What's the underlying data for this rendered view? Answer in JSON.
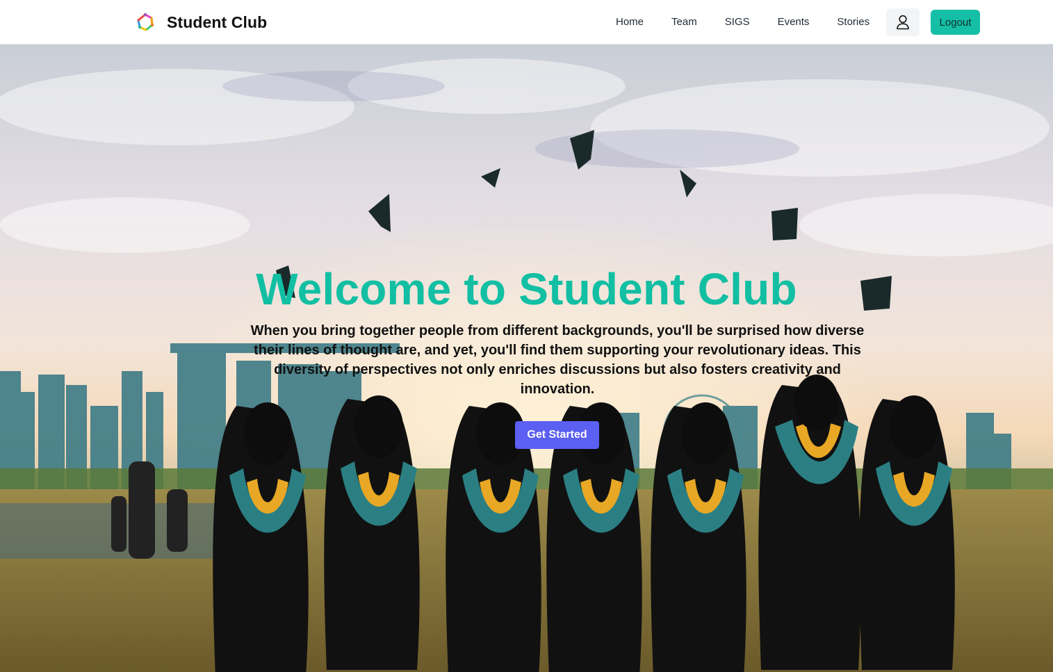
{
  "header": {
    "brand_name": "Student Club",
    "nav": [
      {
        "label": "Home"
      },
      {
        "label": "Team"
      },
      {
        "label": "SIGS"
      },
      {
        "label": "Events"
      },
      {
        "label": "Stories"
      }
    ],
    "user_icon": "user-icon",
    "logout_label": "Logout"
  },
  "hero": {
    "title": "Welcome to Student Club",
    "description": "When you bring together people from different backgrounds, you'll be surprised how diverse their lines of thought are, and yet, you'll find them supporting your revolutionary ideas. This diversity of perspectives not only enriches discussions but also fosters creativity and innovation.",
    "cta_label": "Get Started",
    "background": "graduation-photo"
  },
  "colors": {
    "accent": "#14bfa6",
    "title": "#12bfa3",
    "cta": "#5b5ff2"
  }
}
